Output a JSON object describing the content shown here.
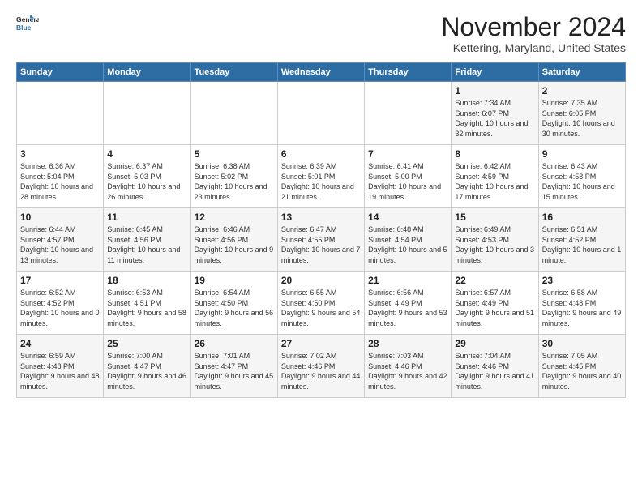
{
  "logo": {
    "line1": "General",
    "line2": "Blue"
  },
  "title": "November 2024",
  "location": "Kettering, Maryland, United States",
  "days_header": [
    "Sunday",
    "Monday",
    "Tuesday",
    "Wednesday",
    "Thursday",
    "Friday",
    "Saturday"
  ],
  "weeks": [
    [
      {
        "day": "",
        "content": ""
      },
      {
        "day": "",
        "content": ""
      },
      {
        "day": "",
        "content": ""
      },
      {
        "day": "",
        "content": ""
      },
      {
        "day": "",
        "content": ""
      },
      {
        "day": "1",
        "content": "Sunrise: 7:34 AM\nSunset: 6:07 PM\nDaylight: 10 hours and 32 minutes."
      },
      {
        "day": "2",
        "content": "Sunrise: 7:35 AM\nSunset: 6:05 PM\nDaylight: 10 hours and 30 minutes."
      }
    ],
    [
      {
        "day": "3",
        "content": "Sunrise: 6:36 AM\nSunset: 5:04 PM\nDaylight: 10 hours and 28 minutes."
      },
      {
        "day": "4",
        "content": "Sunrise: 6:37 AM\nSunset: 5:03 PM\nDaylight: 10 hours and 26 minutes."
      },
      {
        "day": "5",
        "content": "Sunrise: 6:38 AM\nSunset: 5:02 PM\nDaylight: 10 hours and 23 minutes."
      },
      {
        "day": "6",
        "content": "Sunrise: 6:39 AM\nSunset: 5:01 PM\nDaylight: 10 hours and 21 minutes."
      },
      {
        "day": "7",
        "content": "Sunrise: 6:41 AM\nSunset: 5:00 PM\nDaylight: 10 hours and 19 minutes."
      },
      {
        "day": "8",
        "content": "Sunrise: 6:42 AM\nSunset: 4:59 PM\nDaylight: 10 hours and 17 minutes."
      },
      {
        "day": "9",
        "content": "Sunrise: 6:43 AM\nSunset: 4:58 PM\nDaylight: 10 hours and 15 minutes."
      }
    ],
    [
      {
        "day": "10",
        "content": "Sunrise: 6:44 AM\nSunset: 4:57 PM\nDaylight: 10 hours and 13 minutes."
      },
      {
        "day": "11",
        "content": "Sunrise: 6:45 AM\nSunset: 4:56 PM\nDaylight: 10 hours and 11 minutes."
      },
      {
        "day": "12",
        "content": "Sunrise: 6:46 AM\nSunset: 4:56 PM\nDaylight: 10 hours and 9 minutes."
      },
      {
        "day": "13",
        "content": "Sunrise: 6:47 AM\nSunset: 4:55 PM\nDaylight: 10 hours and 7 minutes."
      },
      {
        "day": "14",
        "content": "Sunrise: 6:48 AM\nSunset: 4:54 PM\nDaylight: 10 hours and 5 minutes."
      },
      {
        "day": "15",
        "content": "Sunrise: 6:49 AM\nSunset: 4:53 PM\nDaylight: 10 hours and 3 minutes."
      },
      {
        "day": "16",
        "content": "Sunrise: 6:51 AM\nSunset: 4:52 PM\nDaylight: 10 hours and 1 minute."
      }
    ],
    [
      {
        "day": "17",
        "content": "Sunrise: 6:52 AM\nSunset: 4:52 PM\nDaylight: 10 hours and 0 minutes."
      },
      {
        "day": "18",
        "content": "Sunrise: 6:53 AM\nSunset: 4:51 PM\nDaylight: 9 hours and 58 minutes."
      },
      {
        "day": "19",
        "content": "Sunrise: 6:54 AM\nSunset: 4:50 PM\nDaylight: 9 hours and 56 minutes."
      },
      {
        "day": "20",
        "content": "Sunrise: 6:55 AM\nSunset: 4:50 PM\nDaylight: 9 hours and 54 minutes."
      },
      {
        "day": "21",
        "content": "Sunrise: 6:56 AM\nSunset: 4:49 PM\nDaylight: 9 hours and 53 minutes."
      },
      {
        "day": "22",
        "content": "Sunrise: 6:57 AM\nSunset: 4:49 PM\nDaylight: 9 hours and 51 minutes."
      },
      {
        "day": "23",
        "content": "Sunrise: 6:58 AM\nSunset: 4:48 PM\nDaylight: 9 hours and 49 minutes."
      }
    ],
    [
      {
        "day": "24",
        "content": "Sunrise: 6:59 AM\nSunset: 4:48 PM\nDaylight: 9 hours and 48 minutes."
      },
      {
        "day": "25",
        "content": "Sunrise: 7:00 AM\nSunset: 4:47 PM\nDaylight: 9 hours and 46 minutes."
      },
      {
        "day": "26",
        "content": "Sunrise: 7:01 AM\nSunset: 4:47 PM\nDaylight: 9 hours and 45 minutes."
      },
      {
        "day": "27",
        "content": "Sunrise: 7:02 AM\nSunset: 4:46 PM\nDaylight: 9 hours and 44 minutes."
      },
      {
        "day": "28",
        "content": "Sunrise: 7:03 AM\nSunset: 4:46 PM\nDaylight: 9 hours and 42 minutes."
      },
      {
        "day": "29",
        "content": "Sunrise: 7:04 AM\nSunset: 4:46 PM\nDaylight: 9 hours and 41 minutes."
      },
      {
        "day": "30",
        "content": "Sunrise: 7:05 AM\nSunset: 4:45 PM\nDaylight: 9 hours and 40 minutes."
      }
    ]
  ]
}
